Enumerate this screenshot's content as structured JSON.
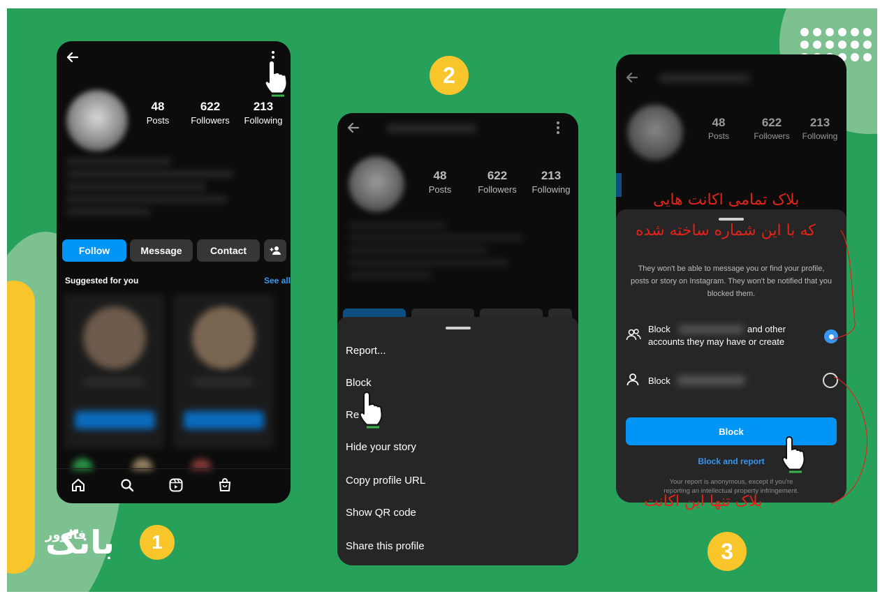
{
  "steps": {
    "one": "1",
    "two": "2",
    "three": "3"
  },
  "phone1": {
    "stats": [
      {
        "value": "48",
        "label": "Posts"
      },
      {
        "value": "622",
        "label": "Followers"
      },
      {
        "value": "213",
        "label": "Following"
      }
    ],
    "buttons": {
      "follow": "Follow",
      "message": "Message",
      "contact": "Contact"
    },
    "suggested_label": "Suggested for you",
    "see_all": "See all"
  },
  "phone2": {
    "stats": [
      {
        "value": "48",
        "label": "Posts"
      },
      {
        "value": "622",
        "label": "Followers"
      },
      {
        "value": "213",
        "label": "Following"
      }
    ],
    "menu": [
      "Report...",
      "Block",
      "Re",
      "Hide your story",
      "Copy profile URL",
      "Show QR code",
      "Share this profile"
    ]
  },
  "phone3": {
    "stats": [
      {
        "value": "48",
        "label": "Posts"
      },
      {
        "value": "622",
        "label": "Followers"
      },
      {
        "value": "213",
        "label": "Following"
      }
    ],
    "description": "They won't be able to message you or find your profile, posts or story on Instagram. They won't be notified that you blocked them.",
    "option1_prefix": "Block",
    "option1_suffix": "and other",
    "option1_line2": "accounts they may have or create",
    "option2_prefix": "Block",
    "block_button": "Block",
    "block_report": "Block and report",
    "footer_line1": "Your report is anonymous, except if you're",
    "footer_line2": "reporting an intellectual property infringement."
  },
  "annotations": {
    "block_all_line1": "بلاک تمامی اکانت هایی",
    "block_all_line2": "که با این شماره ساخته شده",
    "block_only": "بلاک تنها این اکانت"
  },
  "logo": {
    "main": "بانک",
    "sub": "فالوور"
  },
  "colors": {
    "background": "#27a059",
    "accent_yellow": "#f8c62a",
    "instagram_blue": "#0095f6",
    "annotation_red": "#e2231a"
  }
}
